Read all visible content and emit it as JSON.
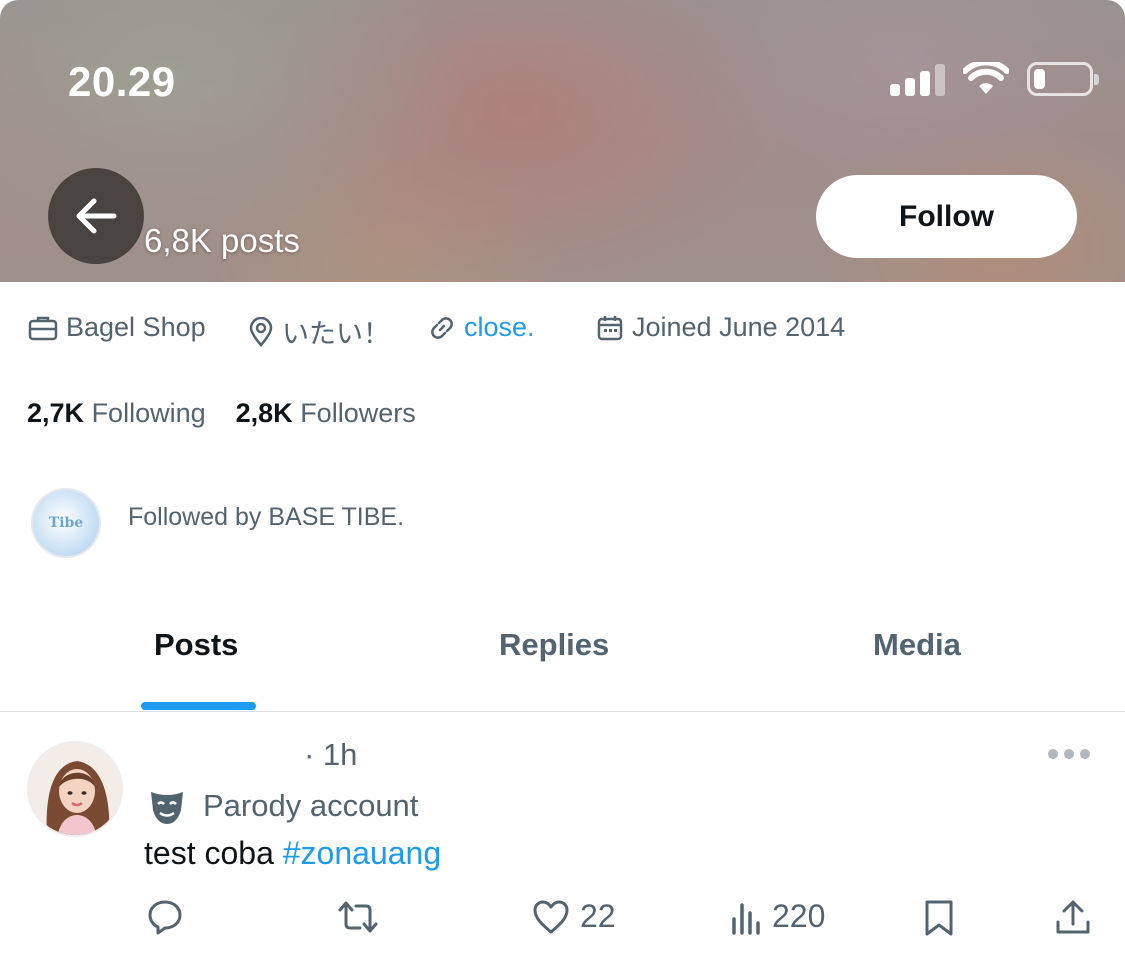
{
  "status_bar": {
    "time": "20.29",
    "icons": [
      "signal-icon",
      "wifi-icon",
      "battery-icon"
    ],
    "battery_level": 0.2
  },
  "header": {
    "posts_count": "6,8K posts",
    "follow_label": "Follow",
    "back_icon": "arrow-left-icon"
  },
  "profile_meta": {
    "profession": "Bagel Shop",
    "location": "いたい！",
    "link": "close.",
    "joined": "Joined June 2014"
  },
  "stats": {
    "following_count": "2,7K",
    "following_label": "Following",
    "followers_count": "2,8K",
    "followers_label": "Followers"
  },
  "followed_by": {
    "text": "Followed by BASE TIBE.",
    "avatar_text": "Tibe"
  },
  "tabs": [
    {
      "label": "Posts",
      "active": true
    },
    {
      "label": "Replies",
      "active": false
    },
    {
      "label": "Media",
      "active": false
    }
  ],
  "post": {
    "time": "· 1h",
    "badge": "Parody account",
    "text": "test coba ",
    "hashtag": "#zonauang",
    "likes": "22",
    "views": "220"
  },
  "colors": {
    "accent": "#1d9bf0",
    "secondary_text": "#536471",
    "primary_text": "#0f1419"
  }
}
